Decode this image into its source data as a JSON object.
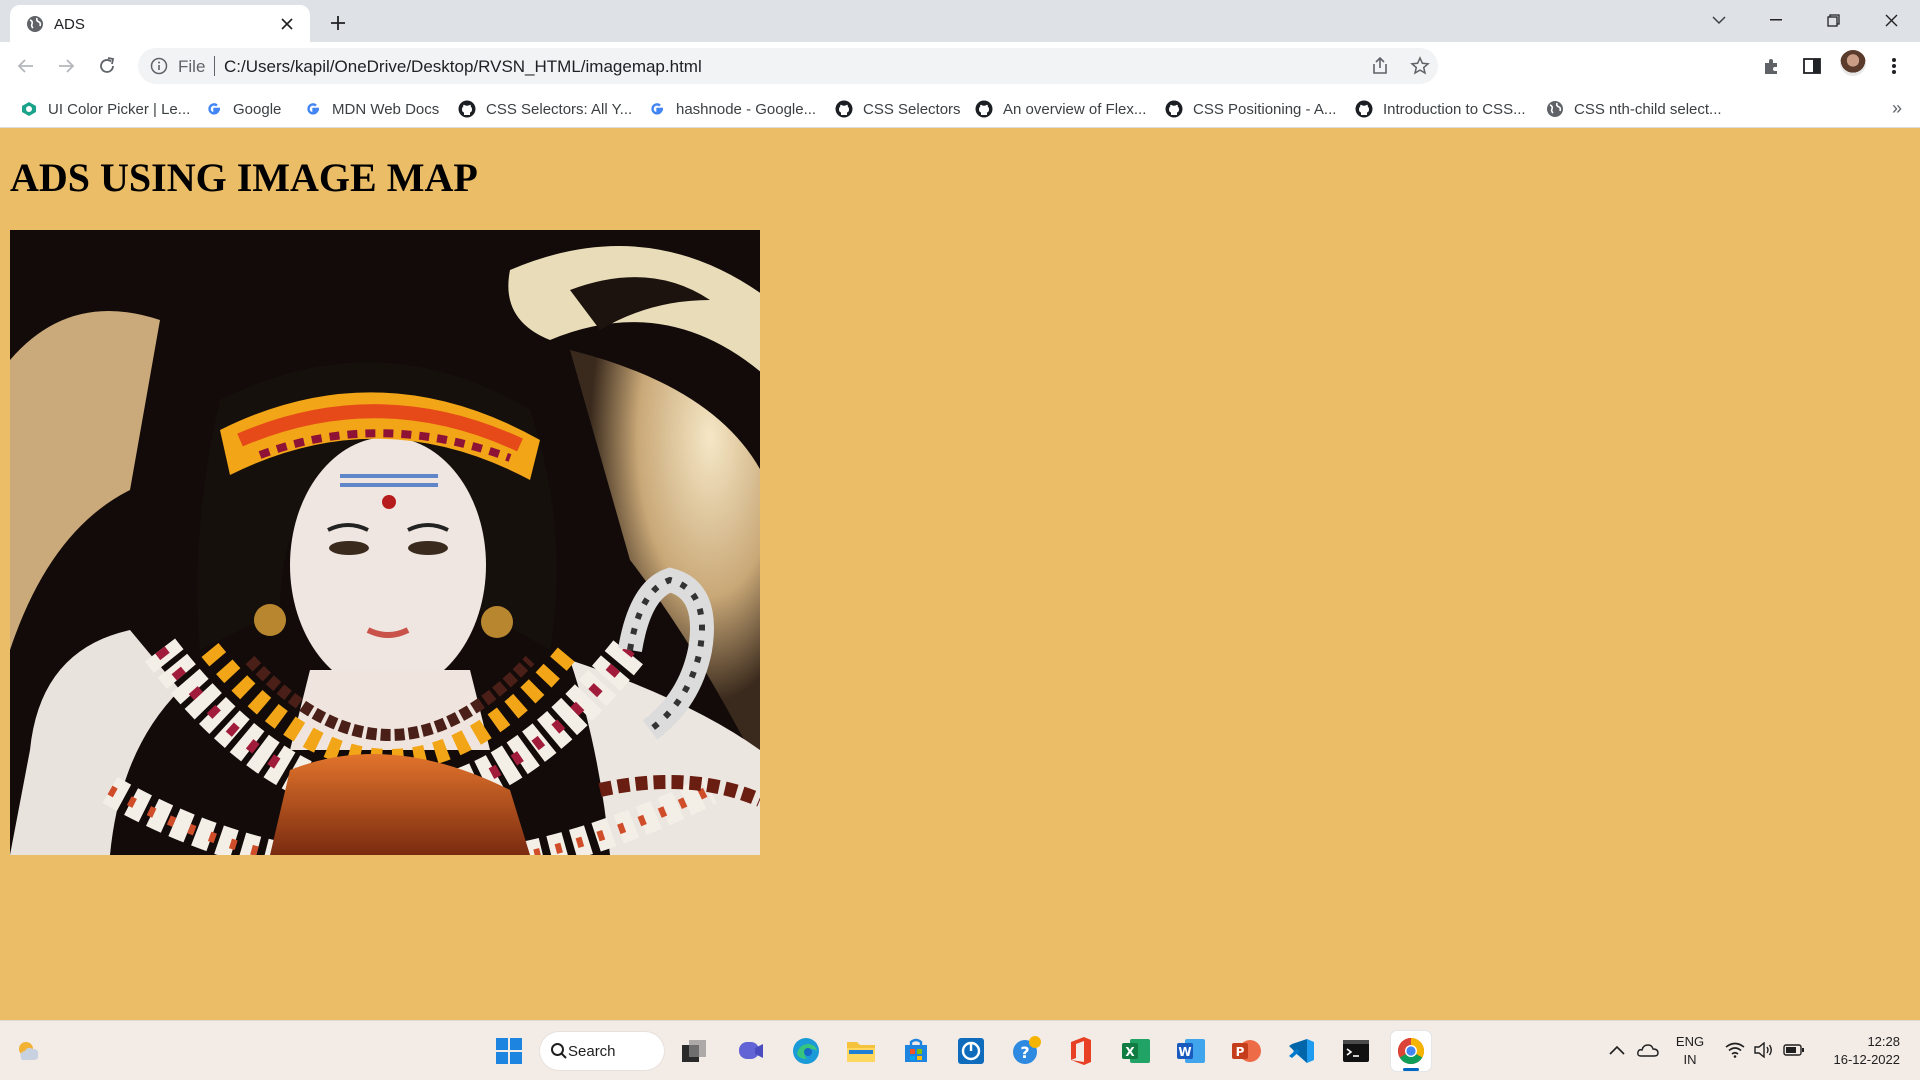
{
  "browser": {
    "tab": {
      "title": "ADS"
    },
    "address": {
      "scheme_label": "File",
      "url": "C:/Users/kapil/OneDrive/Desktop/RVSN_HTML/imagemap.html"
    },
    "bookmarks": [
      {
        "label": "UI Color Picker | Le...",
        "icon": "ui-color-picker-icon"
      },
      {
        "label": "Google",
        "icon": "google-icon"
      },
      {
        "label": "MDN Web Docs",
        "icon": "google-icon"
      },
      {
        "label": "CSS Selectors: All Y...",
        "icon": "github-icon"
      },
      {
        "label": "hashnode - Google...",
        "icon": "google-icon"
      },
      {
        "label": "CSS Selectors",
        "icon": "github-icon"
      },
      {
        "label": "An overview of Flex...",
        "icon": "github-icon"
      },
      {
        "label": "CSS Positioning - A...",
        "icon": "github-icon"
      },
      {
        "label": "Introduction to CSS...",
        "icon": "github-icon"
      },
      {
        "label": "CSS nth-child select...",
        "icon": "globe-icon"
      }
    ],
    "bookmarks_overflow": "»"
  },
  "page": {
    "heading": "ADS USING IMAGE MAP",
    "image": {
      "subject": "statue-deity-photo"
    }
  },
  "taskbar": {
    "search_label": "Search",
    "language_line1": "ENG",
    "language_line2": "IN",
    "time": "12:28",
    "date": "16-12-2022"
  },
  "colors": {
    "page_background": "#ebbd67",
    "tab_strip": "#dee1e6",
    "accent": "#0067c0"
  }
}
